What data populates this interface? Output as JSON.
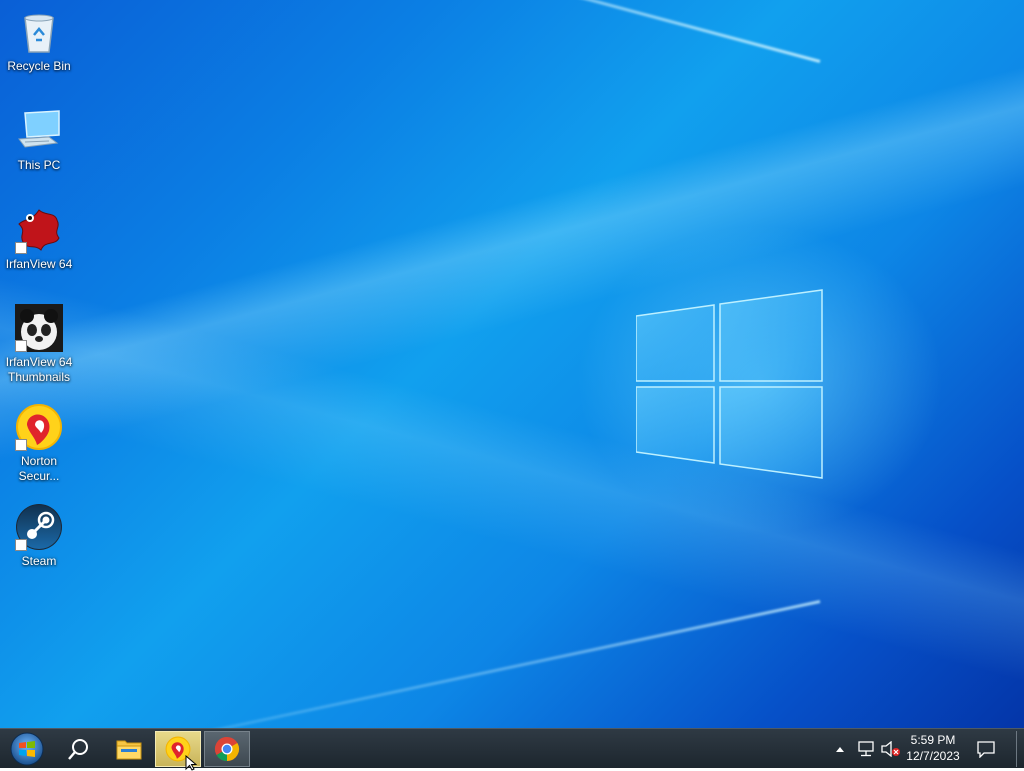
{
  "desktop": {
    "icons": [
      {
        "label": "Recycle Bin",
        "icon": "recycle-bin-icon"
      },
      {
        "label": "This PC",
        "icon": "this-pc-icon"
      },
      {
        "label": "IrfanView 64",
        "icon": "irfanview-icon"
      },
      {
        "label": "IrfanView 64 Thumbnails",
        "icon": "irfanview-thumbnails-icon"
      },
      {
        "label": "Norton Secur...",
        "icon": "norton-security-icon"
      },
      {
        "label": "Steam",
        "icon": "steam-icon"
      }
    ]
  },
  "taskbar": {
    "start": {
      "icon": "windows-start-icon"
    },
    "search": {
      "icon": "search-icon"
    },
    "pinned": [
      {
        "name": "File Explorer",
        "icon": "file-explorer-icon",
        "state": "pinned"
      },
      {
        "name": "Norton Security",
        "icon": "norton-security-icon",
        "state": "active"
      },
      {
        "name": "Google Chrome",
        "icon": "chrome-icon",
        "state": "running"
      }
    ],
    "tray": {
      "icons": [
        "show-hidden-icons-icon",
        "network-icon",
        "volume-muted-icon"
      ],
      "time": "5:59 PM",
      "date": "12/7/2023",
      "notification_icon": "action-center-icon"
    }
  },
  "colors": {
    "desktop_accent": "#0b7fe4",
    "taskbar": "#1d262e",
    "active_button": "#e7d98a"
  }
}
